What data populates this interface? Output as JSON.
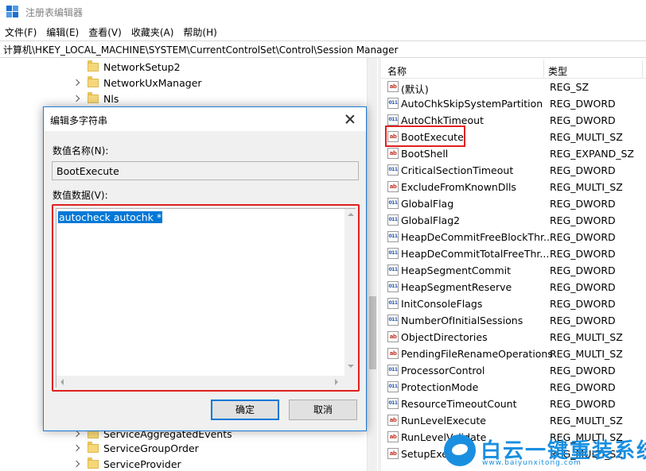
{
  "window": {
    "title": "注册表编辑器"
  },
  "menu": [
    "文件(F)",
    "编辑(E)",
    "查看(V)",
    "收藏夹(A)",
    "帮助(H)"
  ],
  "address": "计算机\\HKEY_LOCAL_MACHINE\\SYSTEM\\CurrentControlSet\\Control\\Session Manager",
  "tree": {
    "items_top": [
      "NetworkSetup2",
      "NetworkUxManager",
      "Nls"
    ],
    "items_bottom": [
      "ServiceAggregatedEvents",
      "ServiceGroupOrder",
      "ServiceProvider"
    ]
  },
  "list": {
    "col_name": "名称",
    "col_type": "类型",
    "rows": [
      {
        "name": "(默认)",
        "type": "REG_SZ",
        "icon": "ab"
      },
      {
        "name": "AutoChkSkipSystemPartition",
        "type": "REG_DWORD",
        "icon": "bin"
      },
      {
        "name": "AutoChkTimeout",
        "type": "REG_DWORD",
        "icon": "bin"
      },
      {
        "name": "BootExecute",
        "type": "REG_MULTI_SZ",
        "icon": "ab"
      },
      {
        "name": "BootShell",
        "type": "REG_EXPAND_SZ",
        "icon": "ab"
      },
      {
        "name": "CriticalSectionTimeout",
        "type": "REG_DWORD",
        "icon": "bin"
      },
      {
        "name": "ExcludeFromKnownDlls",
        "type": "REG_MULTI_SZ",
        "icon": "ab"
      },
      {
        "name": "GlobalFlag",
        "type": "REG_DWORD",
        "icon": "bin"
      },
      {
        "name": "GlobalFlag2",
        "type": "REG_DWORD",
        "icon": "bin"
      },
      {
        "name": "HeapDeCommitFreeBlockThr...",
        "type": "REG_DWORD",
        "icon": "bin"
      },
      {
        "name": "HeapDeCommitTotalFreeThr...",
        "type": "REG_DWORD",
        "icon": "bin"
      },
      {
        "name": "HeapSegmentCommit",
        "type": "REG_DWORD",
        "icon": "bin"
      },
      {
        "name": "HeapSegmentReserve",
        "type": "REG_DWORD",
        "icon": "bin"
      },
      {
        "name": "InitConsoleFlags",
        "type": "REG_DWORD",
        "icon": "bin"
      },
      {
        "name": "NumberOfInitialSessions",
        "type": "REG_DWORD",
        "icon": "bin"
      },
      {
        "name": "ObjectDirectories",
        "type": "REG_MULTI_SZ",
        "icon": "ab"
      },
      {
        "name": "PendingFileRenameOperations",
        "type": "REG_MULTI_SZ",
        "icon": "ab"
      },
      {
        "name": "ProcessorControl",
        "type": "REG_DWORD",
        "icon": "bin"
      },
      {
        "name": "ProtectionMode",
        "type": "REG_DWORD",
        "icon": "bin"
      },
      {
        "name": "ResourceTimeoutCount",
        "type": "REG_DWORD",
        "icon": "bin"
      },
      {
        "name": "RunLevelExecute",
        "type": "REG_MULTI_SZ",
        "icon": "ab"
      },
      {
        "name": "RunLevelValidate",
        "type": "REG_MULTI_SZ",
        "icon": "ab"
      },
      {
        "name": "SetupExecute",
        "type": "REG_MULTI_SZ",
        "icon": "ab"
      }
    ]
  },
  "dialog": {
    "title": "编辑多字符串",
    "name_label": "数值名称(N):",
    "name_value": "BootExecute",
    "data_label": "数值数据(V):",
    "data_value": "autocheck autochk *",
    "ok_label": "确定",
    "cancel_label": "取消"
  },
  "watermark": {
    "title": "白云一键重装系统",
    "url": "www.baiyunxitong.com"
  }
}
